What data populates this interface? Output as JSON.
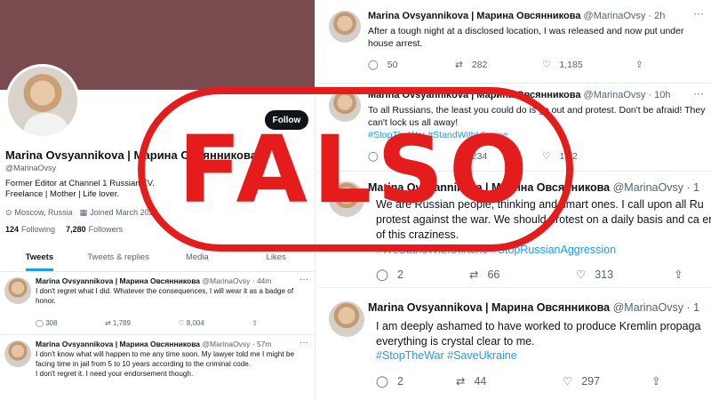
{
  "profile": {
    "name": "Marina Ovsyannikova | Марина Овсянникова",
    "handle": "@MarinaOvsy",
    "follow_label": "Follow",
    "bio_line1": "Former Editor at Channel 1 Russian TV.",
    "bio_line2": "Freelance | Mother | Life lover.",
    "location": "Moscow, Russia",
    "joined": "Joined March 2022",
    "following_count": "124",
    "following_label": "Following",
    "followers_count": "7,280",
    "followers_label": "Followers",
    "tabs": [
      "Tweets",
      "Tweets & replies",
      "Media",
      "Likes"
    ]
  },
  "left_tweets": [
    {
      "name": "Marina Ovsyannikova | Марина Овсянникова",
      "meta": "@MarinaOvsy · 44m",
      "text": "I don't regret what I did. Whatever the consequences, I will wear it as a badge of honor.",
      "replies": "308",
      "retweets": "1,789",
      "likes": "8,004"
    },
    {
      "name": "Marina Ovsyannikova | Марина Овсянникова",
      "meta": "@MarinaOvsy · 57m",
      "text": "I don't know what will happen to me any time soon. My lawyer told me I might be facing time in jail from 5 to 10 years according to the criminal code.",
      "text2": "I don't regret it. I need your endorsement though."
    }
  ],
  "right_tweets": [
    {
      "name": "Marina Ovsyannikova | Марина Овсянникова",
      "meta": "@MarinaOvsy · 2h",
      "text": "After a tough night at a disclosed location, I was released and now put under house arrest.",
      "tags": "",
      "replies": "50",
      "retweets": "282",
      "likes": "1,185"
    },
    {
      "name": "Marina Ovsyannikova | Марина Овсянникова",
      "meta": "@MarinaOvsy · 10h",
      "text": "To all Russians, the least you could do is go out and protest. Don't be afraid! They can't lock us all away!",
      "tags": "#StopTheWar #StandWithUkraine",
      "replies": "",
      "retweets": "234",
      "likes": "1,12"
    },
    {
      "name": "Marina Ovsyannikova | Марина Овсянникова",
      "meta": "@MarinaOvsy · 1",
      "text": "We are Russian people, thinking and smart ones. I call upon all Ru protest against the war. We should protest on a daily basis and ca end of this craziness.",
      "tags": "#WeStandWithUkraine #StopRussianAggression",
      "replies": "2",
      "retweets": "66",
      "likes": "313"
    },
    {
      "name": "Marina Ovsyannikova | Марина Овсянникова",
      "meta": "@MarinaOvsy · 1",
      "text": "I am deeply ashamed to have worked to produce Kremlin propaga everything is crystal clear to me.",
      "tags": "#StopTheWar #SaveUkraine",
      "replies": "2",
      "retweets": "44",
      "likes": "297"
    }
  ],
  "stamp": {
    "text": "FALSO",
    "color": "#e41c1c"
  },
  "icons": {
    "reply": "speech-bubble",
    "retweet": "retweet-arrows",
    "like": "heart",
    "share": "upload-arrow",
    "more": "ellipsis",
    "location": "location-pin",
    "calendar": "calendar"
  },
  "colors": {
    "banner": "#7a4b4e",
    "link": "#1d9bf0",
    "stamp": "#e41c1c"
  }
}
